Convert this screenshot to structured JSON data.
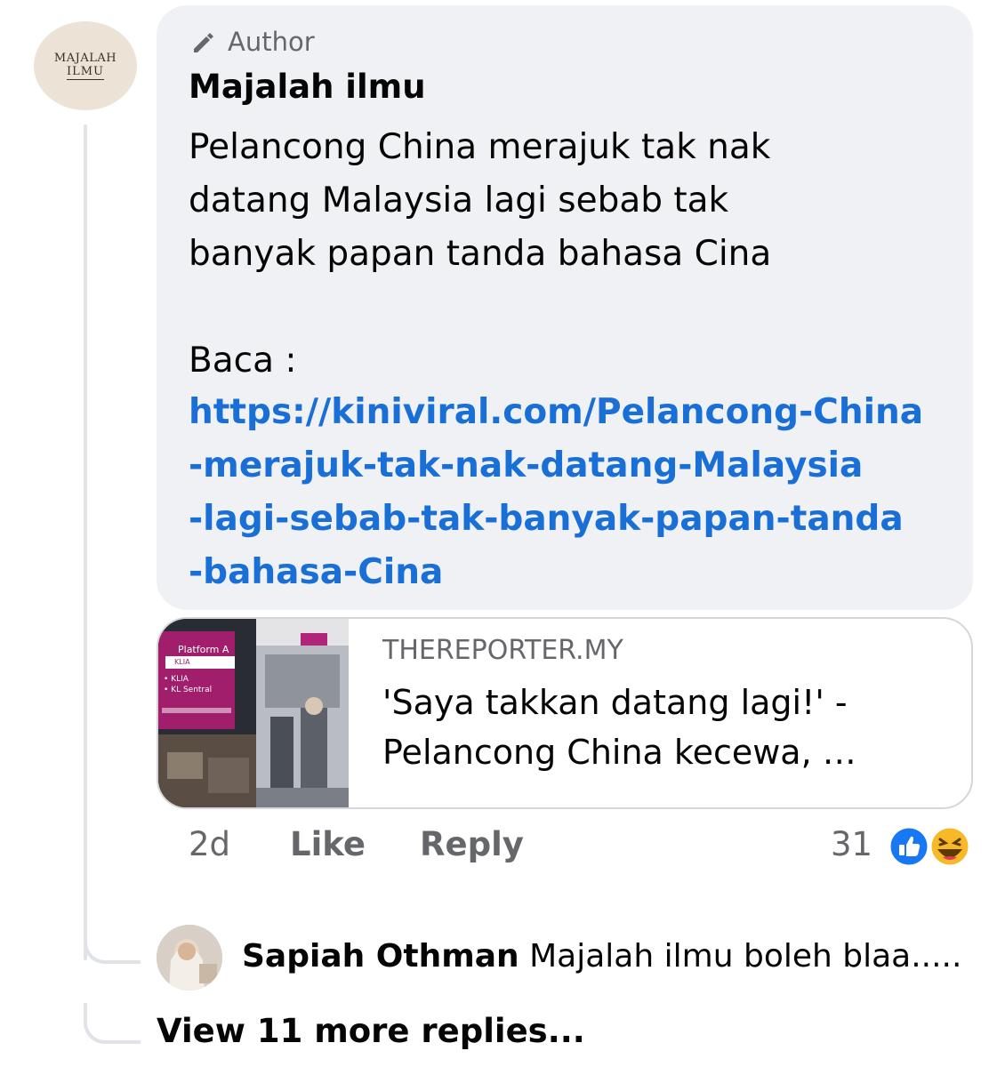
{
  "avatar": {
    "line1": "MAJALAH",
    "line2": "ILMU"
  },
  "comment": {
    "badge": "Author",
    "name": "Majalah ilmu",
    "text_lines": [
      "Pelancong China merajuk tak nak",
      "datang Malaysia lagi sebab tak",
      "banyak papan tanda bahasa Cina"
    ],
    "read_label": "Baca :",
    "link_lines": [
      "https://kiniviral.com/Pelancong-China",
      "-merajuk-tak-nak-datang-Malaysia",
      "-lagi-sebab-tak-banyak-papan-tanda",
      "-bahasa-Cina"
    ]
  },
  "link_preview": {
    "thumb_sign": "Platform A",
    "thumb_sign_2": "KLIA",
    "thumb_list": [
      "• KLIA",
      "• KL Sentral"
    ],
    "domain": "THEREPORTER.MY",
    "title_lines": [
      "'Saya takkan datang lagi!' -",
      "Pelancong China kecewa, …"
    ]
  },
  "actions": {
    "time": "2d",
    "like": "Like",
    "reply": "Reply",
    "reaction_count": "31"
  },
  "reactions": [
    "like-icon",
    "haha-icon"
  ],
  "colors": {
    "link": "#1a6fd6",
    "bubble": "#eff1f4",
    "muted": "#65676b",
    "like_blue": "#1877f2",
    "haha_yellow": "#f7b928"
  },
  "reply": {
    "name": "Sapiah Othman",
    "text": "Majalah ilmu boleh blaa....."
  },
  "view_more": "View 11 more replies..."
}
